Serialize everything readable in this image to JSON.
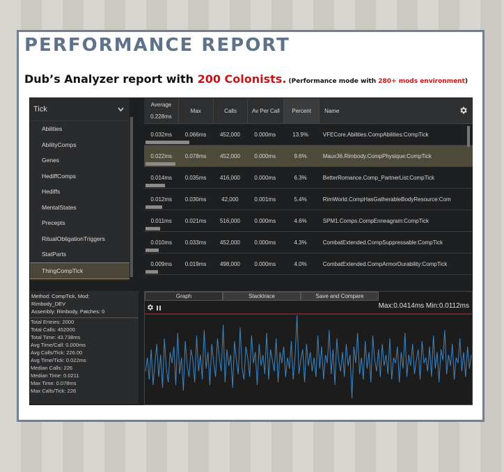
{
  "page": {
    "title": "PERFORMANCE REPORT",
    "subtitle_pre": "Dub’s Analyzer report with ",
    "subtitle_num": "200 Colonists.",
    "subtitle_small_pre": " (Performance mode with ",
    "subtitle_small_red": "280+ mods environment",
    "subtitle_small_post": ")"
  },
  "sidebar": {
    "category": "Tick",
    "items": [
      "Abilities",
      "AbilityComps",
      "Genes",
      "HediffComps",
      "Hediffs",
      "MentalStates",
      "Precepts",
      "RitualObligationTriggers",
      "StatParts",
      "ThingCompTick"
    ],
    "selected_index": 9
  },
  "table": {
    "headers": {
      "average": "Average",
      "average_value": "0.228ms",
      "max": "Max",
      "calls": "Calls",
      "av_per_call": "Av Per Call",
      "percent": "Percent",
      "name": "Name"
    },
    "rows": [
      {
        "avg": "0.032ms",
        "max": "0.066ms",
        "calls": "452,000",
        "apc": "0.000ms",
        "pct": "13.9%",
        "name": "VFECore.Abilities.CompAbilities:CompTick",
        "bar": 0.139
      },
      {
        "avg": "0.022ms",
        "max": "0.078ms",
        "calls": "452,000",
        "apc": "0.000ms",
        "pct": "9.6%",
        "name": "Maux36.Rimbody.CompPhysique:CompTick",
        "bar": 0.096
      },
      {
        "avg": "0.014ms",
        "max": "0.035ms",
        "calls": "416,000",
        "apc": "0.000ms",
        "pct": "6.3%",
        "name": "BetterRomance.Comp_PartnerList:CompTick",
        "bar": 0.063
      },
      {
        "avg": "0.012ms",
        "max": "0.030ms",
        "calls": "42,000",
        "apc": "0.001ms",
        "pct": "5.4%",
        "name": "RimWorld.CompHasGatherableBodyResource:Com",
        "bar": 0.054
      },
      {
        "avg": "0.011ms",
        "max": "0.021ms",
        "calls": "516,000",
        "apc": "0.000ms",
        "pct": "4.6%",
        "name": "SPM1.Comps.CompEnneagram:CompTick",
        "bar": 0.046
      },
      {
        "avg": "0.010ms",
        "max": "0.033ms",
        "calls": "452,000",
        "apc": "0.000ms",
        "pct": "4.3%",
        "name": "CombatExtended.CompSuppressable:CompTick",
        "bar": 0.043
      },
      {
        "avg": "0.009ms",
        "max": "0.019ms",
        "calls": "498,000",
        "apc": "0.000ms",
        "pct": "4.0%",
        "name": "CombatExtended.CompArmorDurability:CompTick",
        "bar": 0.04
      }
    ],
    "selected_index": 1
  },
  "details": {
    "method_line1": "Method: CompTick, Mod:",
    "method_line2": "Rimbody_DEV",
    "method_line3": "Assembly: Rimbody, Patches: 0",
    "stats": [
      "Total Entries: 2000",
      "Total Calls: 452000",
      "Total Time: 43.738ms",
      "Avg Time/Call: 0.000ms",
      "Avg Calls/Tick: 226.00",
      "Avg Time/Tick: 0.022ms",
      "Median Calls: 226",
      "Median Time: 0.0211",
      "Max Time: 0.078ms",
      "Max Calls/Tick: 226"
    ]
  },
  "graph": {
    "tabs": [
      "Graph",
      "Stacktrace",
      "Save and Compare"
    ],
    "range_label": "Max:0.0414ms Min:0.0112ms",
    "max": 0.0414,
    "min": 0.0112,
    "line_color": "#3f86c0",
    "max_line_color": "#c03030",
    "samples": [
      0.021,
      0.026,
      0.018,
      0.029,
      0.016,
      0.024,
      0.031,
      0.019,
      0.027,
      0.015,
      0.033,
      0.022,
      0.017,
      0.028,
      0.024,
      0.03,
      0.016,
      0.035,
      0.02,
      0.026,
      0.014,
      0.032,
      0.023,
      0.019,
      0.029,
      0.025,
      0.017,
      0.034,
      0.021,
      0.027,
      0.018,
      0.036,
      0.022,
      0.028,
      0.016,
      0.031,
      0.024,
      0.019,
      0.033,
      0.026,
      0.021,
      0.038,
      0.017,
      0.029,
      0.023,
      0.027,
      0.015,
      0.032,
      0.025,
      0.02,
      0.037,
      0.022,
      0.018,
      0.03,
      0.026,
      0.019,
      0.034,
      0.024,
      0.028,
      0.016,
      0.031,
      0.023,
      0.027,
      0.02,
      0.035,
      0.018,
      0.029,
      0.025,
      0.021,
      0.033,
      0.017,
      0.028,
      0.024,
      0.03,
      0.019,
      0.026,
      0.022,
      0.032,
      0.018,
      0.027,
      0.0414,
      0.02,
      0.025,
      0.029,
      0.017,
      0.031,
      0.023,
      0.028,
      0.021,
      0.026,
      0.019,
      0.034,
      0.022,
      0.03,
      0.018,
      0.027,
      0.024,
      0.036,
      0.02,
      0.029,
      0.016,
      0.033,
      0.025,
      0.021,
      0.028,
      0.019,
      0.031,
      0.023,
      0.027,
      0.0112,
      0.03,
      0.024,
      0.035,
      0.02,
      0.026,
      0.018,
      0.032,
      0.022,
      0.028,
      0.017,
      0.034,
      0.025,
      0.021,
      0.029,
      0.019,
      0.031,
      0.023,
      0.027,
      0.02,
      0.033,
      0.018,
      0.026,
      0.024,
      0.03,
      0.017,
      0.028,
      0.022,
      0.035,
      0.019,
      0.027,
      0.023,
      0.031,
      0.02,
      0.025,
      0.029,
      0.018,
      0.032,
      0.024,
      0.026,
      0.021,
      0.03,
      0.019,
      0.034,
      0.022,
      0.028,
      0.017,
      0.029,
      0.025,
      0.036,
      0.02,
      0.027,
      0.023,
      0.031,
      0.018,
      0.026,
      0.024,
      0.033,
      0.021,
      0.028,
      0.019,
      0.03,
      0.022,
      0.027
    ]
  }
}
